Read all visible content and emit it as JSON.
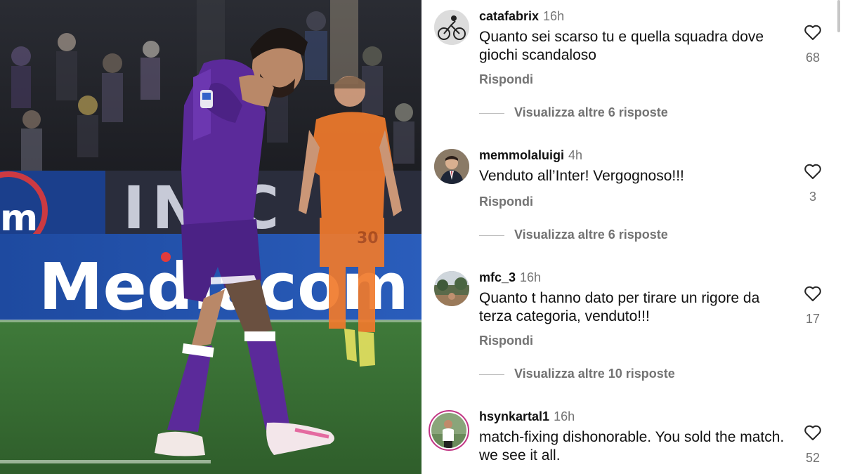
{
  "photo": {
    "banner_sponsor": "Mediacom",
    "banner_brand": "m",
    "banner_letters": "IN C",
    "player_shirt_number": "30"
  },
  "comments": [
    {
      "username": "catafabrix",
      "time": "16h",
      "text": "Quanto sei scarso tu e quella squadra dove giochi scandaloso",
      "reply_label": "Rispondi",
      "more_replies": "Visualizza altre 6 risposte",
      "likes": "68",
      "avatar_icon": "cyclist-avatar-icon"
    },
    {
      "username": "memmolaluigi",
      "time": "4h",
      "text": "Venduto all’Inter! Vergognoso!!!",
      "reply_label": "Rispondi",
      "more_replies": "Visualizza altre 6 risposte",
      "likes": "3",
      "avatar_icon": "man-suit-avatar-icon"
    },
    {
      "username": "mfc_3",
      "time": "16h",
      "text": "Quanto t hanno dato per tirare un rigore da terza categoria, venduto!!!",
      "reply_label": "Rispondi",
      "more_replies": "Visualizza altre 10 risposte",
      "likes": "17",
      "avatar_icon": "landscape-avatar-icon"
    },
    {
      "username": "hsynkartal1",
      "time": "16h",
      "text": "match-fixing dishonorable. You sold the match. we see it all.",
      "reply_label": "",
      "more_replies": "",
      "likes": "52",
      "avatar_icon": "story-ring-avatar-icon"
    }
  ],
  "colors": {
    "story_ring": "#c13584",
    "fiorentina_purple": "#5b2a9a",
    "inter_orange": "#f07a2c",
    "banner_blue": "#1f4fa8",
    "secondary_text": "#737373"
  }
}
